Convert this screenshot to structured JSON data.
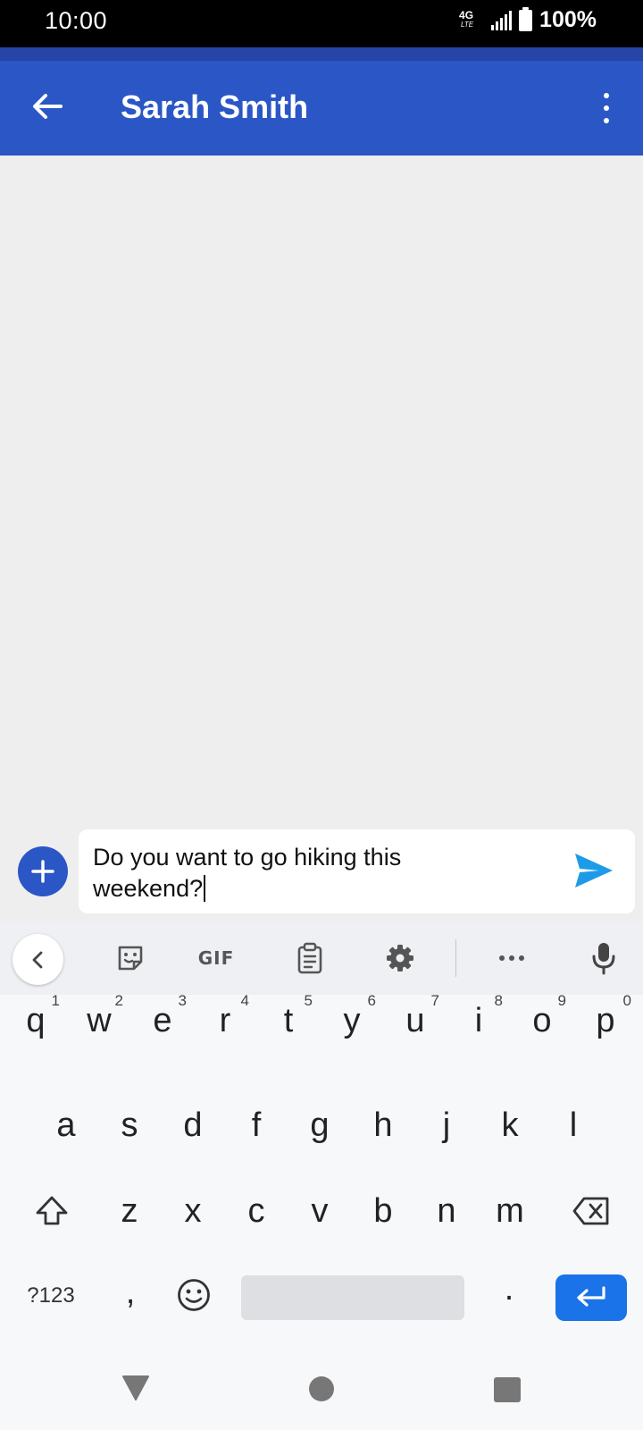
{
  "status_bar": {
    "time": "10:00",
    "network": "4G",
    "network_sub": "LTE",
    "battery": "100%",
    "icons": [
      "lte-icon",
      "signal-icon",
      "battery-icon"
    ]
  },
  "header": {
    "title": "Sarah Smith",
    "back_icon": "arrow-back-icon",
    "menu_icon": "more-vert-icon"
  },
  "compose": {
    "text_line1": "Do you want to go hiking this",
    "text_line2": "weekend?",
    "add_icon": "plus-icon",
    "send_icon": "send-icon"
  },
  "keyboard": {
    "toolbar": {
      "gif_label": "GIF",
      "icons": [
        "chevron-left-icon",
        "sticker-icon",
        "gif-icon",
        "clipboard-icon",
        "settings-icon",
        "more-horiz-icon",
        "mic-icon"
      ]
    },
    "row1": [
      "q",
      "w",
      "e",
      "r",
      "t",
      "y",
      "u",
      "i",
      "o",
      "p"
    ],
    "row1_hints": [
      "1",
      "2",
      "3",
      "4",
      "5",
      "6",
      "7",
      "8",
      "9",
      "0"
    ],
    "row2": [
      "a",
      "s",
      "d",
      "f",
      "g",
      "h",
      "j",
      "k",
      "l"
    ],
    "row3": [
      "z",
      "x",
      "c",
      "v",
      "b",
      "n",
      "m"
    ],
    "symbols_label": "?123",
    "comma": ",",
    "period": "."
  },
  "colors": {
    "app_bar": "#2A56C6",
    "status_strip": "#2546A6",
    "conversation_bg": "#EEEEEE",
    "send": "#1E9BE8",
    "enter_key": "#1A73E8"
  }
}
